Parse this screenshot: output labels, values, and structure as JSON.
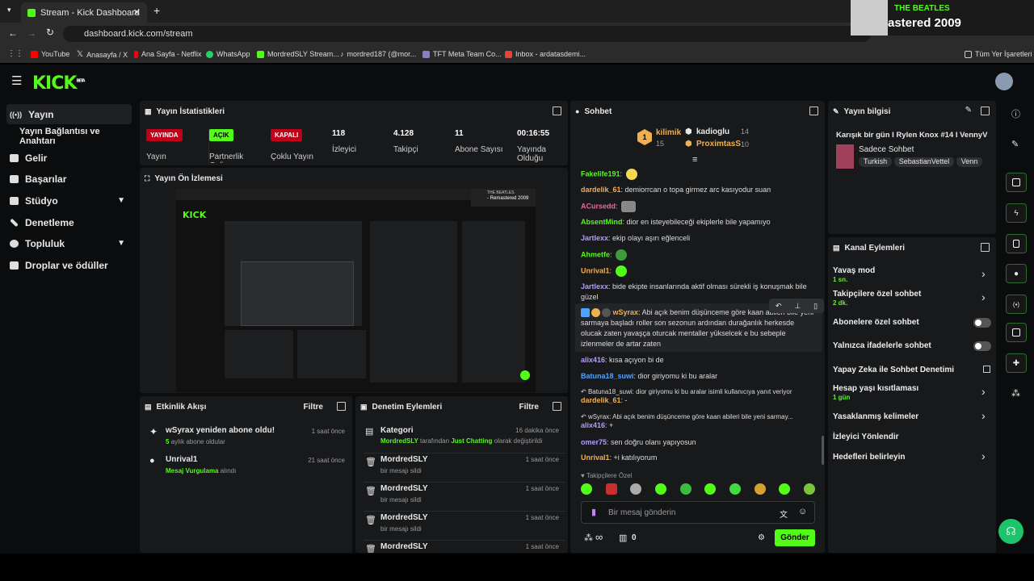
{
  "browser": {
    "tab_title": "Stream - Kick Dashboard",
    "url": "dashboard.kick.com/stream",
    "bookmarks": [
      "YouTube",
      "Anasayfa / X",
      "Ana Sayfa - Netflix",
      "WhatsApp",
      "MordredSLY Stream...",
      "mordred187 (@mor...",
      "TFT Meta Team Co...",
      "Inbox - ardatasdemi..."
    ],
    "bookmarks_all": "Tüm Yer İşaretleri",
    "media": {
      "artist": "THE BEATLES",
      "title": "astered 2009"
    }
  },
  "brand": {
    "logo": "KICK",
    "beta": "BETA",
    "accent": "#53fc18"
  },
  "sidebar": {
    "items": [
      {
        "label": "Yayın",
        "icon": "broadcast-icon"
      },
      {
        "label": "Yayın Bağlantısı ve Anahtarı"
      },
      {
        "label": "Gelir",
        "icon": "revenue-icon"
      },
      {
        "label": "Başarılar",
        "icon": "achievements-icon"
      },
      {
        "label": "Stüdyo",
        "icon": "studio-icon"
      },
      {
        "label": "Denetleme",
        "icon": "wrench-icon"
      },
      {
        "label": "Topluluk",
        "icon": "community-icon"
      },
      {
        "label": "Droplar ve ödüller",
        "icon": "gift-icon"
      }
    ]
  },
  "stats": {
    "title": "Yayın İstatistikleri",
    "items": [
      {
        "badge": "YAYINDA",
        "label": "Yayın"
      },
      {
        "badge": "AÇIK",
        "label": "Partnerlik Gelir"
      },
      {
        "badge": "KAPALI",
        "label": "Çoklu Yayın"
      },
      {
        "value": "118",
        "label": "İzleyici"
      },
      {
        "value": "4.128",
        "label": "Takipçi"
      },
      {
        "value": "11",
        "label": "Abone Sayısı"
      },
      {
        "value": "00:16:55",
        "label": "Yayında Olduğu"
      }
    ]
  },
  "preview": {
    "title": "Yayın Ön İzlemesi",
    "artist": "THE BEATLES",
    "song": "- Remastered 2009"
  },
  "feed": {
    "title": "Etkinlik Akışı",
    "filter": "Filtre",
    "items": [
      {
        "user": "wSyrax yeniden abone oldu!",
        "highlight": "5",
        "detail": " aylık abone oldular",
        "time": "1 saat önce"
      },
      {
        "user": "Unrival1",
        "highlight": "Mesaj Vurgulama",
        "detail": " alındı",
        "time": "21 saat önce"
      }
    ]
  },
  "mod": {
    "title": "Denetim Eylemleri",
    "filter": "Filtre",
    "items": [
      {
        "title": "Kategori",
        "who": "MordredSLY",
        "mid": " tarafından ",
        "cat": "Just Chatting",
        "end": " olarak değiştirildi",
        "time": "16 dakika önce"
      },
      {
        "title": "MordredSLY",
        "detail": "bir mesajı sildi",
        "time": "1 saat önce"
      },
      {
        "title": "MordredSLY",
        "detail": "bir mesajı sildi",
        "time": "1 saat önce"
      },
      {
        "title": "MordredSLY",
        "detail": "bir mesajı sildi",
        "time": "1 saat önce"
      },
      {
        "title": "MordredSLY",
        "detail": "bir mesajı sildi",
        "time": "1 saat önce"
      }
    ]
  },
  "chat": {
    "title": "Sohbet",
    "top": [
      {
        "name": "kilimik",
        "count": "15"
      },
      {
        "name": "kadioglu",
        "count": "14"
      },
      {
        "name": "ProximtasS",
        "count": "10"
      }
    ],
    "messages": [
      {
        "user": "Fakelife191",
        "color": "#53fc18",
        "text": ""
      },
      {
        "user": "dardelik_61",
        "color": "#f0b04f",
        "text": "demiorrcan o topa girmez arc kasıyodur suan"
      },
      {
        "user": "ACursedd",
        "color": "#e56b9a",
        "text": ""
      },
      {
        "user": "AbsentMind",
        "color": "#53fc18",
        "text": "dior en isteyebileceği ekiplerle bile yapamıyo"
      },
      {
        "user": "Jartlexx",
        "color": "#b19cff",
        "text": "ekip olayı aşırı eğlenceli"
      },
      {
        "user": "Ahmetfe",
        "color": "#53fc18",
        "text": ""
      },
      {
        "user": "Unrival1",
        "color": "#f0b04f",
        "text": ""
      },
      {
        "user": "Jartlexx",
        "color": "#b19cff",
        "text": "bide ekipte insanlarında aktif olması sürekli iş konuşmak bile güzel"
      },
      {
        "user": "wSyrax",
        "color": "#f0b04f",
        "text": "Abi açık benim düşünceme göre kaan abileri bile yeni sarmaya başladı roller son sezonun ardından durağanlık herkesde olucak zaten yavaşça oturcak mentaller yükselcek e bu sebeple izlenmeler de artar zaten"
      },
      {
        "user": "alix416",
        "color": "#b19cff",
        "text": "kısa açıyon bi de"
      },
      {
        "user": "Batuna18_suwi",
        "color": "#4fa3ff",
        "text": "dior giriyomu ki bu aralar"
      },
      {
        "reply": "Batuna18_suwi: dior giriyomu ki bu aralar isimli kullanıcıya yanıt veriyor",
        "user": "dardelik_61",
        "color": "#f0b04f",
        "text": "-"
      },
      {
        "reply": "wSyrax: Abi açık benim düşünceme göre kaan abileri bile yeni sarmay...",
        "user": "alix416",
        "color": "#b19cff",
        "text": "+"
      },
      {
        "user": "omer75",
        "color": "#b19cff",
        "text": "sen doğru olanı yapıyosun"
      },
      {
        "user": "Unrival1",
        "color": "#f0b04f",
        "text": "+i katılıyorum"
      }
    ],
    "followers_only": "Takipçilere Özel",
    "placeholder": "Bir mesaj gönderin",
    "infinity": "∞",
    "gift_count": "0",
    "send": "Gönder"
  },
  "info": {
    "title": "Yayın bilgisi",
    "stream_title": "Karışık bir gün I Rylen Knox #14 I VennyV",
    "category": "Sadece Sohbet",
    "tags": [
      "Turkish",
      "SebastianVettel",
      "Venn"
    ]
  },
  "actions": {
    "title": "Kanal Eylemleri",
    "items": [
      {
        "label": "Yavaş mod",
        "sub": "1 sn.",
        "ctrl": "arrow"
      },
      {
        "label": "Takipçilere özel sohbet",
        "sub": "2 dk.",
        "ctrl": "arrow"
      },
      {
        "label": "Abonelere özel sohbet",
        "ctrl": "toggle"
      },
      {
        "label": "Yalnızca ifadelerle sohbet",
        "ctrl": "toggle"
      },
      {
        "label": "Yapay Zeka ile Sohbet Denetimi",
        "ctrl": "ext"
      },
      {
        "label": "Hesap yaşı kısıtlaması",
        "sub": "1 gün",
        "ctrl": "arrow"
      },
      {
        "label": "Yasaklanmış kelimeler",
        "ctrl": "arrow"
      },
      {
        "label": "İzleyici Yönlendir",
        "ctrl": "none"
      },
      {
        "label": "Hedefleri belirleyin",
        "ctrl": "arrow"
      }
    ]
  }
}
